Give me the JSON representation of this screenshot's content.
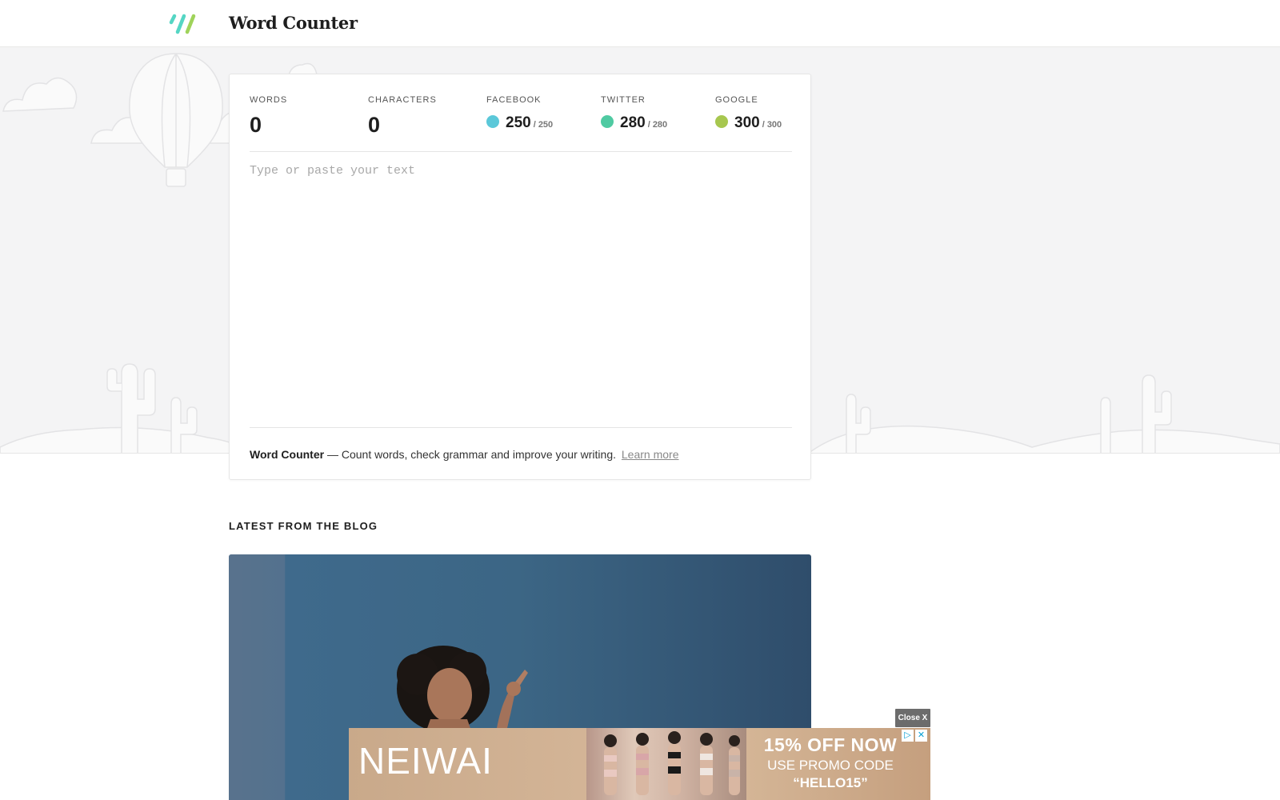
{
  "header": {
    "brand": "Word Counter",
    "logo_icon": "double-slash-logo-icon",
    "logo_colors": [
      "#55d6c4",
      "#9fd35a"
    ]
  },
  "stats": {
    "words": {
      "label": "WORDS",
      "value": "0"
    },
    "characters": {
      "label": "CHARACTERS",
      "value": "0"
    },
    "facebook": {
      "label": "FACEBOOK",
      "value": "250",
      "max": "/ 250",
      "color": "#5bc8d9"
    },
    "twitter": {
      "label": "TWITTER",
      "value": "280",
      "max": "/ 280",
      "color": "#4fcaa2"
    },
    "google": {
      "label": "GOOGLE",
      "value": "300",
      "max": "/ 300",
      "color": "#a7c74f"
    }
  },
  "editor": {
    "placeholder": "Type or paste your text",
    "value": ""
  },
  "footer": {
    "brand": "Word Counter",
    "tagline": "— Count words, check grammar and improve your writing.",
    "link": "Learn more"
  },
  "blog": {
    "heading": "LATEST FROM THE BLOG"
  },
  "ad": {
    "close_label": "Close X",
    "brand": "NEIWAI",
    "line1": "15% OFF NOW",
    "line2": "USE PROMO CODE",
    "line3": "“HELLO15”",
    "adchoices_label": "▷",
    "dismiss_label": "✕"
  }
}
